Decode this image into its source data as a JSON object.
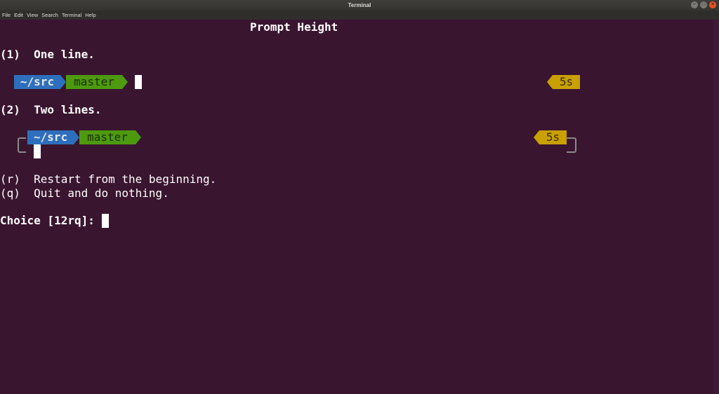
{
  "window": {
    "title": "Terminal",
    "controls": {
      "minimize": "–",
      "maximize": "□",
      "close": "×"
    }
  },
  "menu": [
    "File",
    "Edit",
    "View",
    "Search",
    "Terminal",
    "Help"
  ],
  "terminal": {
    "heading": "Prompt Height",
    "option1": "(1)  One line.",
    "option2": "(2)  Two lines.",
    "prompt": {
      "dir": "~/src",
      "branch": "master",
      "duration": "5s"
    },
    "restart": "(r)  Restart from the beginning.",
    "quit": "(q)  Quit and do nothing.",
    "choice": "Choice [12rq]: "
  },
  "colors": {
    "background": "#3a1530",
    "dir_segment": "#2e6fbd",
    "branch_segment": "#4d9a0f",
    "time_segment": "#c9a000"
  }
}
